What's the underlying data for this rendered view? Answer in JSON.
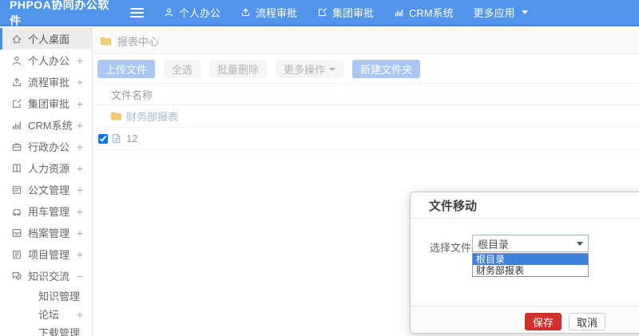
{
  "colors": {
    "navbar_bg": "#5194ec",
    "navbar_border": "#3f83dd",
    "active_item_border": "#4a90e2",
    "primary_btn_bg": "#a9c7f0",
    "link_blue": "#a3bce6",
    "folder_yellow": "#f1cf6d",
    "save_red": "#d2322c",
    "option_highlight": "#3c81dc"
  },
  "navbar": {
    "logo": "PHPOA协同办公软件",
    "items": [
      {
        "label": "个人办公",
        "icon": "person"
      },
      {
        "label": "流程审批",
        "icon": "upload"
      },
      {
        "label": "集团审批",
        "icon": "edit"
      },
      {
        "label": "CRM系统",
        "icon": "chart"
      },
      {
        "label": "更多应用",
        "icon": "",
        "caret": true
      }
    ]
  },
  "sidebar": {
    "items": [
      {
        "label": "个人桌面",
        "icon": "home",
        "expand": "",
        "active": true
      },
      {
        "label": "个人办公",
        "icon": "person",
        "expand": "+"
      },
      {
        "label": "流程审批",
        "icon": "upload",
        "expand": "+"
      },
      {
        "label": "集团审批",
        "icon": "edit",
        "expand": "+"
      },
      {
        "label": "CRM系统",
        "icon": "chart",
        "expand": "+"
      },
      {
        "label": "行政办公",
        "icon": "briefcase",
        "expand": "+"
      },
      {
        "label": "人力资源",
        "icon": "book",
        "expand": "+"
      },
      {
        "label": "公文管理",
        "icon": "doc",
        "expand": "+"
      },
      {
        "label": "用车管理",
        "icon": "car",
        "expand": "+"
      },
      {
        "label": "档案管理",
        "icon": "archive",
        "expand": "+"
      },
      {
        "label": "项目管理",
        "icon": "project",
        "expand": "+"
      },
      {
        "label": "知识交流",
        "icon": "chat",
        "expand": "−"
      },
      {
        "label": "知识管理",
        "sub": true,
        "expand": ""
      },
      {
        "label": "论坛",
        "sub": true,
        "expand": "+"
      },
      {
        "label": "下载管理",
        "sub": true,
        "expand": ""
      }
    ]
  },
  "breadcrumb": {
    "label": "报表中心"
  },
  "toolbar": {
    "buttons": [
      {
        "label": "上传文件",
        "style": "primary"
      },
      {
        "label": "全选",
        "style": "default"
      },
      {
        "label": "批量删除",
        "style": "default"
      },
      {
        "label": "更多操作",
        "style": "default",
        "caret": true
      },
      {
        "label": "新建文件夹",
        "style": "primary"
      }
    ]
  },
  "file_table": {
    "header": "文件名称",
    "rows": [
      {
        "type": "folder",
        "name": "财务部报表",
        "checked": false
      },
      {
        "type": "file",
        "name": "12",
        "checked": true
      }
    ]
  },
  "modal": {
    "title": "文件移动",
    "label": "选择文件夹",
    "select_value": "根目录",
    "options": [
      {
        "label": "根目录",
        "selected": true
      },
      {
        "label": "财务部报表",
        "selected": false
      }
    ],
    "save_label": "保存",
    "cancel_label": "取消"
  }
}
